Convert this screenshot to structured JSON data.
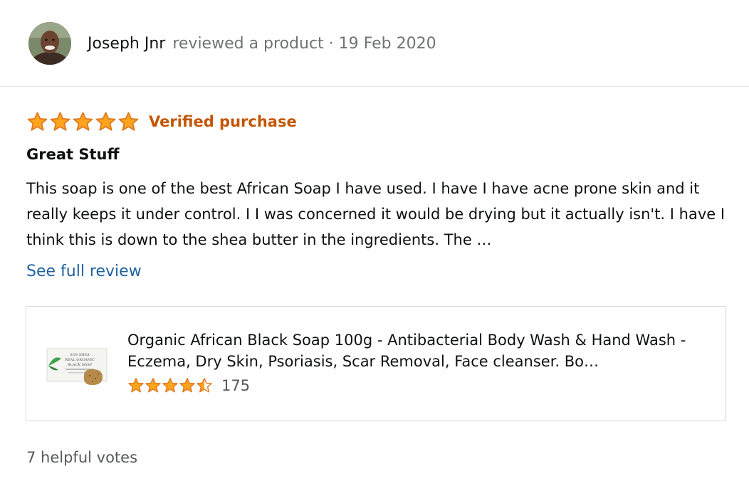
{
  "reviewer": {
    "name": "Joseph Jnr",
    "meta": "reviewed a product · 19 Feb 2020"
  },
  "review": {
    "rating": 5,
    "rating_max": 5,
    "verified_label": "Verified purchase",
    "title": "Great Stuff",
    "body": "This soap is one of the best African Soap I have used. I have I have acne prone skin and it really keeps it under control. I I was concerned it would be drying but it actually isn't. I have I think this is down to the shea butter in the ingredients. The …",
    "see_full_label": "See full review"
  },
  "product": {
    "title": "Organic African Black Soap 100g - Antibacterial Body Wash & Hand Wash - Eczema, Dry Skin, Psoriasis, Scar Removal, Face cleanser. Bo…",
    "rating": 4.5,
    "rating_max": 5,
    "rating_count": "175",
    "thumbnail_icon": "soap-product-image",
    "thumb_label_lines": [
      "SOS SHEA",
      "REAL ORGANIC",
      "BLACK SOAP"
    ]
  },
  "helpful_votes": "7 helpful votes",
  "colors": {
    "star_fill": "#ffa41c",
    "star_stroke": "#de7921",
    "verified": "#c45500",
    "link": "#2162a1",
    "muted_text": "#565959"
  }
}
